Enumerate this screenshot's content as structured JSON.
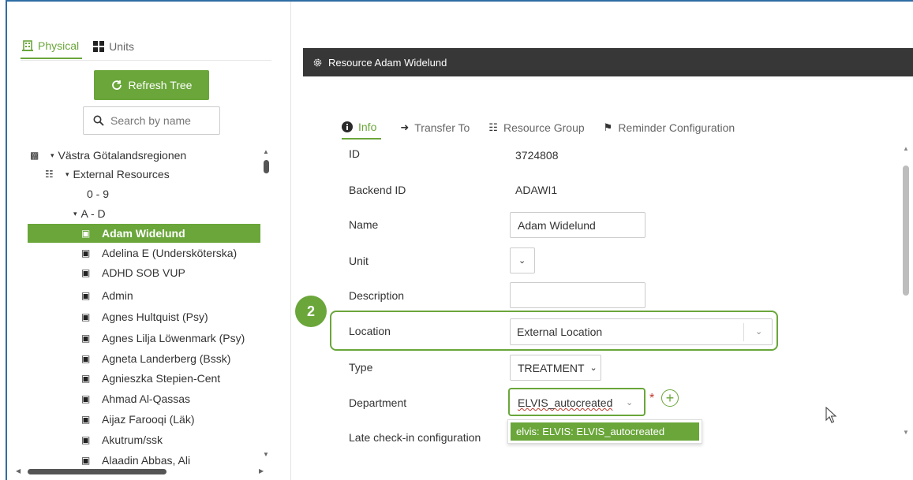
{
  "left_panel": {
    "tabs": [
      {
        "label": "Physical",
        "icon": "building-icon",
        "active": true
      },
      {
        "label": "Units",
        "icon": "grid-icon",
        "active": false
      }
    ],
    "refresh_label": "Refresh Tree",
    "search_placeholder": "Search by name",
    "tree": [
      {
        "label": "Västra Götalandsregionen",
        "level": 0,
        "caret": "▾",
        "icon": "org-icon"
      },
      {
        "label": "External Resources",
        "level": 1,
        "caret": "▾",
        "icon": "resource-group-icon"
      },
      {
        "label": "0 - 9",
        "level": 2,
        "caret": "",
        "icon": ""
      },
      {
        "label": "A - D",
        "level": 2,
        "caret": "▾",
        "icon": ""
      },
      {
        "label": "Adam Widelund",
        "level": 3,
        "icon": "person-icon",
        "selected": true
      },
      {
        "label": "Adelina E (Undersköterska)",
        "level": 3,
        "icon": "person-icon"
      },
      {
        "label": "ADHD SOB VUP",
        "level": 3,
        "icon": "person-icon"
      },
      {
        "label": "Admin",
        "level": 3,
        "icon": "person-icon"
      },
      {
        "label": "Agnes Hultquist (Psy)",
        "level": 3,
        "icon": "person-icon"
      },
      {
        "label": "Agnes Lilja Löwenmark (Psy)",
        "level": 3,
        "icon": "person-icon"
      },
      {
        "label": "Agneta Landerberg (Bssk)",
        "level": 3,
        "icon": "person-icon"
      },
      {
        "label": "Agnieszka Stepien-Cent",
        "level": 3,
        "icon": "person-icon"
      },
      {
        "label": "Ahmad Al-Qassas",
        "level": 3,
        "icon": "person-icon"
      },
      {
        "label": "Aijaz Farooqi (Läk)",
        "level": 3,
        "icon": "person-icon"
      },
      {
        "label": "Akutrum/ssk",
        "level": 3,
        "icon": "person-icon"
      },
      {
        "label": "Alaadin Abbas, Ali",
        "level": 3,
        "icon": "person-icon"
      }
    ]
  },
  "resource": {
    "header_title": "Resource Adam Widelund",
    "tabs": [
      {
        "label": "Info",
        "icon": "info-icon",
        "active": true
      },
      {
        "label": "Transfer To",
        "icon": "arrow-right-icon",
        "active": false
      },
      {
        "label": "Resource Group",
        "icon": "resource-group-icon",
        "active": false
      },
      {
        "label": "Reminder Configuration",
        "icon": "bell-icon",
        "active": false
      }
    ],
    "fields": {
      "id": {
        "label": "ID",
        "value": "3724808"
      },
      "backend_id": {
        "label": "Backend ID",
        "value": "ADAWI1"
      },
      "name": {
        "label": "Name",
        "value": "Adam Widelund"
      },
      "unit": {
        "label": "Unit",
        "value": ""
      },
      "description": {
        "label": "Description",
        "value": ""
      },
      "location": {
        "label": "Location",
        "value": "External Location"
      },
      "type": {
        "label": "Type",
        "value": "TREATMENT"
      },
      "department": {
        "label": "Department",
        "value": "ELVIS_autocreated",
        "required_mark": "*"
      },
      "late_checkin": {
        "label": "Late check-in configuration"
      }
    },
    "department_dropdown_option": "elvis: ELVIS: ELVIS_autocreated",
    "step_badge": "2"
  },
  "colors": {
    "accent_green": "#6aa63a",
    "header_dark": "#373737",
    "frame_blue": "#2e6da4",
    "required_red": "#c0392b"
  }
}
